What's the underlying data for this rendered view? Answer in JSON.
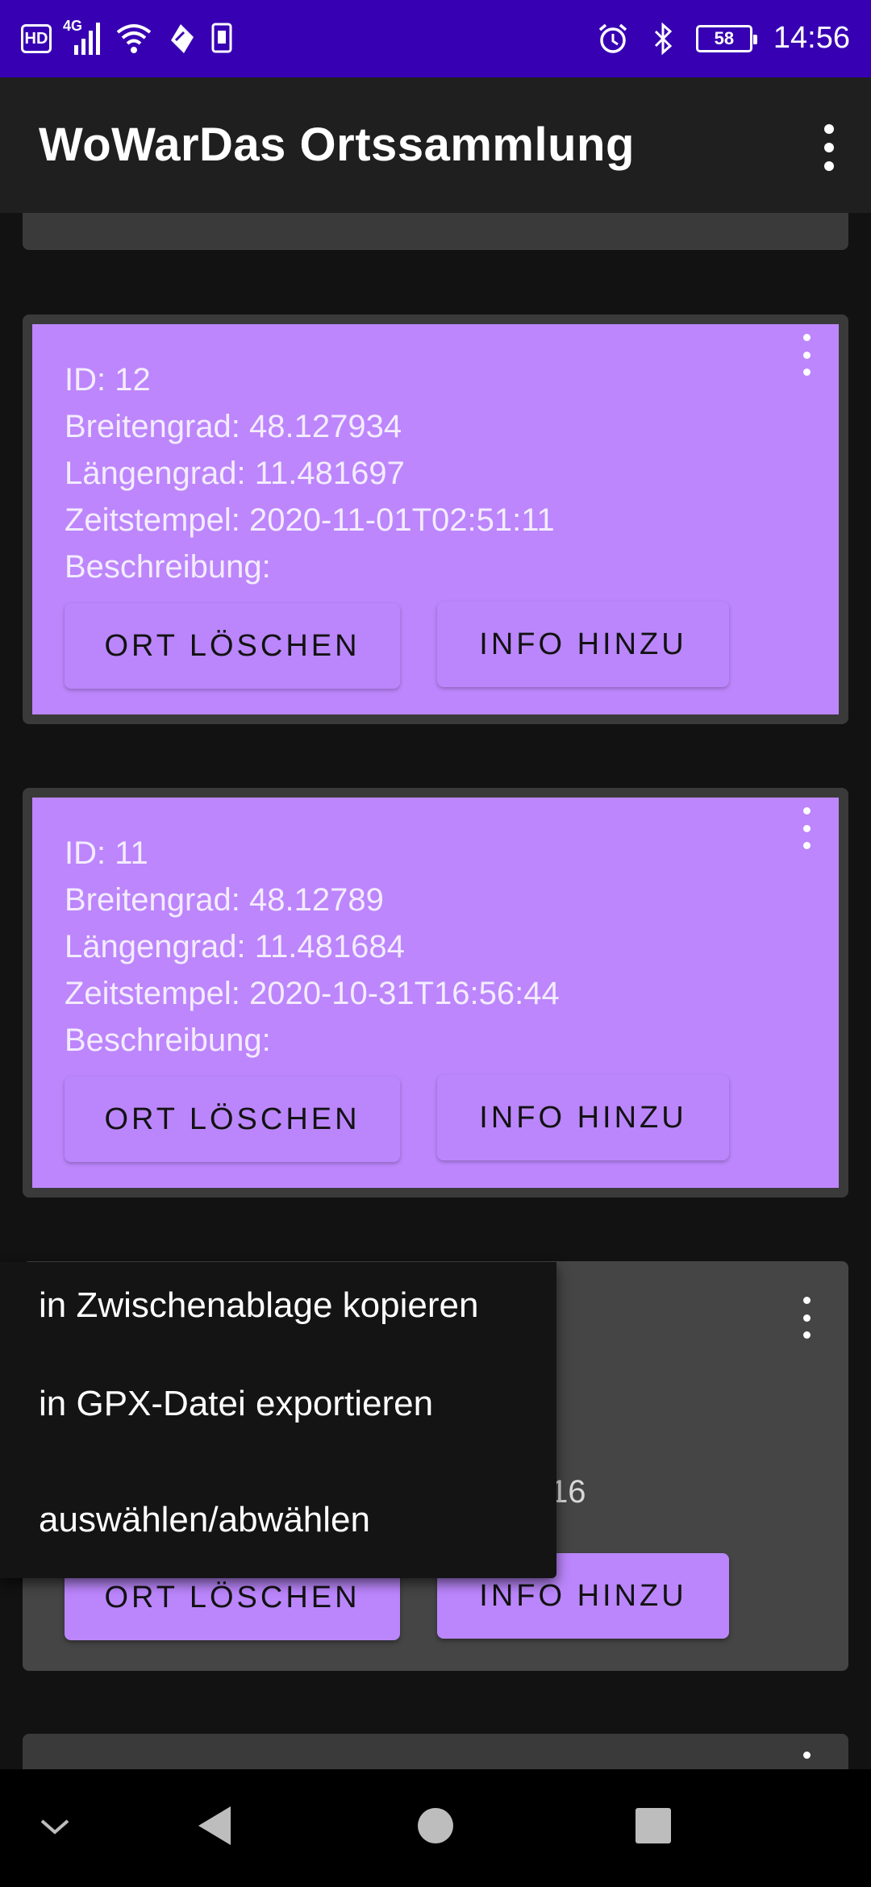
{
  "status_bar": {
    "hd_label": "HD",
    "network_label": "4G",
    "battery_level": "58",
    "time": "14:56"
  },
  "app_bar": {
    "title": "WoWarDas Ortssammlung"
  },
  "cards": [
    {
      "fields": [],
      "delete_label": "",
      "info_label": ""
    },
    {
      "fields": [
        "ID: 12",
        "Breitengrad: 48.127934",
        "Längengrad: 11.481697",
        "Zeitstempel: 2020-11-01T02:51:11",
        "Beschreibung:"
      ],
      "delete_label": "ORT LÖSCHEN",
      "info_label": "INFO HINZU"
    },
    {
      "fields": [
        "ID: 11",
        "Breitengrad: 48.12789",
        "Längengrad: 11.481684",
        "Zeitstempel: 2020-10-31T16:56:44",
        "Beschreibung:"
      ],
      "delete_label": "ORT LÖSCHEN",
      "info_label": "INFO HINZU"
    },
    {
      "partial_text": "16",
      "delete_label": "ORT LÖSCHEN",
      "info_label": "INFO HINZU"
    }
  ],
  "popup_menu": {
    "items": [
      "in Zwischenablage kopieren",
      "in GPX-Datei exportieren",
      "auswählen/abwählen"
    ]
  },
  "colors": {
    "status_bar": "#3700b3",
    "app_bar": "#1f1f1f",
    "background": "#121212",
    "card_selected": "#bd86fc",
    "card_default": "#3a3a3a",
    "button": "#bb86fc"
  }
}
